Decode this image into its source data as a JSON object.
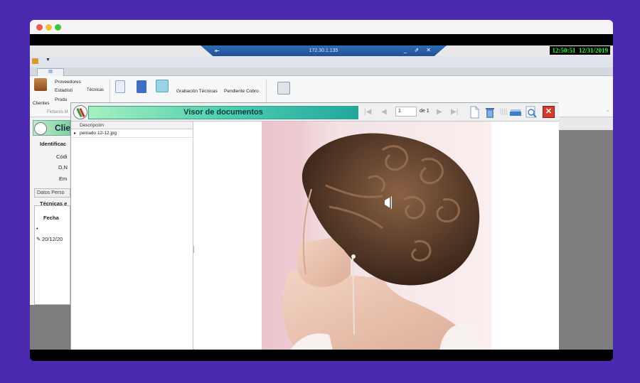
{
  "mac_window": {
    "buttons": [
      "close",
      "minimize",
      "zoom"
    ]
  },
  "rdp": {
    "ip": "172.30.1.135",
    "controls": "_ ⇗ ✕",
    "pin_icon": "pin-icon"
  },
  "clock": {
    "time": "12:50:51",
    "date": "12/31/2019",
    "color": "#1bff2b"
  },
  "ribbon": {
    "clientes": "Clientes",
    "proveedores": "Proveedores",
    "estadisticas": "Estadísti",
    "productos": "Produ",
    "tecnicas_partial": "Técnicas",
    "group_label": "Ficheros M",
    "grabacion": "Grabación Técnicas",
    "pendiente": "Pendiente Cobro"
  },
  "left_form": {
    "title": "Clie",
    "identificacion": "Identificac",
    "codigo": "Códi",
    "dni": "D.N",
    "email": "Em",
    "datos_tab": "Datos Perso",
    "tecnicas": "Técnicas e",
    "fecha_header": "Fecha",
    "new_row_marker": "•",
    "row_marker": "✎",
    "row_date": "20/12/20"
  },
  "viewer": {
    "title": "Visor de documentos",
    "page_current": "1",
    "page_of": "de 1",
    "list_header": "Descripción",
    "files": [
      {
        "name": "peinado 12-12.jpg"
      }
    ],
    "close_label": "✕",
    "colors": {
      "title_start": "#a7f0bf",
      "title_end": "#21a89d",
      "close": "#d63a2c"
    }
  }
}
